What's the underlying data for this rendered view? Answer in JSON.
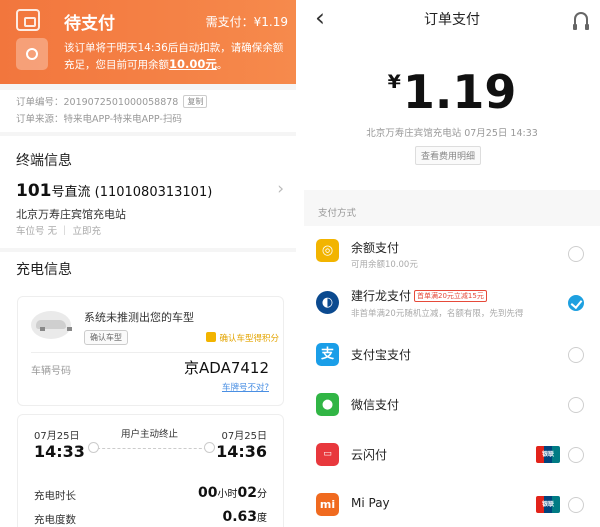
{
  "left": {
    "status": {
      "title": "待支付",
      "due": "需支付：¥1.19",
      "note_pre": "该订单将于明天14:36后自动扣款，请确保余额充足，您目前可用余额",
      "note_balance": "10.00元",
      "note_end": "。"
    },
    "order": {
      "number": "订单编号：2019072501000058878",
      "copy_label": "复制",
      "source": "订单来源：特来电APP-特来电APP-扫码"
    },
    "terminal": {
      "section_title": "终端信息",
      "number": "101",
      "name": "号直流 (1101080313101)",
      "station": "北京万寿庄宾馆充电站",
      "meta": "车位号 无 ｜ 立即充"
    },
    "charging": {
      "section_title": "充电信息",
      "car_unrecognized": "系统未推测出您的车型",
      "confirm_model_btn": "确认车型",
      "confirm_model_link": "确认车型得积分",
      "plate_label": "车辆号码",
      "plate_value": "京ADA7412",
      "plate_wrong": "车牌号不对?",
      "start_date": "07月25日",
      "start_time": "14:33",
      "end_date": "07月25日",
      "end_time": "14:36",
      "stop_reason": "用户主动终止",
      "duration_label": "充电时长",
      "duration_h": "00",
      "duration_h_unit": "小时",
      "duration_m": "02",
      "duration_m_unit": "分",
      "energy_label": "充电度数",
      "energy_value": "0.63",
      "energy_unit": "度"
    }
  },
  "right": {
    "header": {
      "title": "订单支付"
    },
    "amount_currency": "¥",
    "amount": "1.19",
    "meta": "北京万寿庄宾馆充电站 07月25日 14:33",
    "fee_detail_btn": "查看费用明细",
    "methods_label": "支付方式",
    "methods": [
      {
        "name": "余额支付",
        "sub": "可用余额10.00元",
        "icon": "wallet-icon",
        "color": "#f2b400",
        "selected": false
      },
      {
        "name": "建行龙支付",
        "promo": "首单满20元立减15元",
        "sub": "非首单满20元随机立减，名额有限，先到先得",
        "icon": "ccb-icon",
        "color": "#0b4a8f",
        "selected": true
      },
      {
        "name": "支付宝支付",
        "icon": "alipay-icon",
        "color": "#1a9ee8",
        "selected": false
      },
      {
        "name": "微信支付",
        "icon": "wechat-icon",
        "color": "#31b545",
        "selected": false
      },
      {
        "name": "云闪付",
        "icon": "quickpass-icon",
        "color": "#e8383d",
        "selected": false
      },
      {
        "name": "Mi Pay",
        "icon": "mi-icon",
        "color": "#f06a1f",
        "selected": false
      }
    ],
    "unionpay_label": "银联",
    "colors": {
      "accent": "#f2763d",
      "selected": "#1ea0e0",
      "link": "#4a8fe3"
    }
  }
}
